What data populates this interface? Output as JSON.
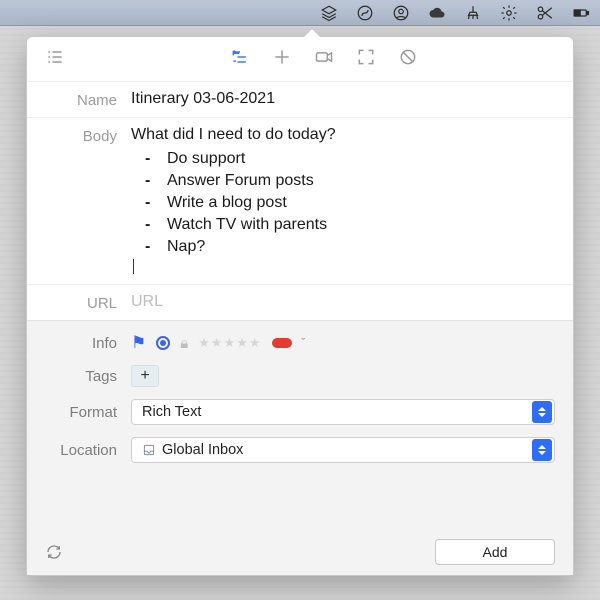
{
  "menubar": {
    "items": [
      "layers",
      "swirl",
      "person",
      "cloud",
      "brush",
      "gear",
      "scissors",
      "battery"
    ]
  },
  "toolbar": {
    "list": "list-view",
    "modes": [
      "rich-text",
      "markdown",
      "video",
      "fullscreen",
      "disable"
    ]
  },
  "fields": {
    "name_label": "Name",
    "name_value": "Itinerary 03-06-2021",
    "body_label": "Body",
    "body_question": "What did I need to do today?",
    "body_items": [
      "Do support",
      "Answer Forum posts",
      "Write a blog post",
      "Watch TV with parents",
      "Nap?"
    ],
    "url_label": "URL",
    "url_placeholder": "URL"
  },
  "info": {
    "label": "Info",
    "flagged": true,
    "unread": true,
    "locked": false,
    "rating": 0,
    "label_color": "#e33b2e"
  },
  "tags": {
    "label": "Tags",
    "add": "+"
  },
  "format": {
    "label": "Format",
    "value": "Rich Text"
  },
  "location": {
    "label": "Location",
    "value": "Global Inbox"
  },
  "footer": {
    "add": "Add"
  }
}
